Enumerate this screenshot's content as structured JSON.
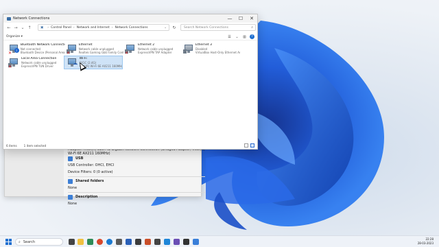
{
  "window": {
    "title": "Network Connections",
    "controls": {
      "minimize": "—",
      "maximize": "☐",
      "close": "✕"
    }
  },
  "nav": {
    "breadcrumb": [
      "Control Panel",
      "Network and Internet",
      "Network Connections"
    ],
    "search_placeholder": "Search Network Connections"
  },
  "command": {
    "organize": "Organize ▾"
  },
  "connections": [
    {
      "name": "Bluetooth Network Connection",
      "status": "Not connected",
      "device": "Bluetooth Device (Personal Area ...",
      "type": "bluetooth",
      "disconnected": true
    },
    {
      "name": "Ethernet",
      "status": "Network cable unplugged",
      "device": "Realtek Gaming GbE Family Contr...",
      "type": "ethernet",
      "disconnected": true
    },
    {
      "name": "Ethernet 2",
      "status": "Network cable unplugged",
      "device": "ExpressVPN TAP Adapter",
      "type": "ethernet",
      "disconnected": true
    },
    {
      "name": "Ethernet 3",
      "status": "Disabled",
      "device": "VirtualBox Host-Only Ethernet Ad...",
      "type": "ethernet",
      "disconnected": false
    },
    {
      "name": "Local Area Connection",
      "status": "Network cable unplugged",
      "device": "ExpressVPN TUN Driver",
      "type": "ethernet",
      "disconnected": true
    },
    {
      "name": "Wi-Fi",
      "status": "EX1C (2.4G)",
      "device": "Intel(R) Wi-Fi 6E AX211 160MHz",
      "type": "wifi",
      "disconnected": false,
      "selected": true
    }
  ],
  "status": {
    "count": "6 items",
    "selected": "1 item selected"
  },
  "background_window": {
    "adapter": "Adapter:  Intel(R) 82574L Gigabit Network Connection (Bridged Adapter, Intel(R) Wi-Fi 6E AX211 160MHz)",
    "usb_title": "USB",
    "usb_controller": "USB Controller:  OHCI, EHCI",
    "device_filters": "Device Filters:  0 (0 active)",
    "shared_title": "Shared folders",
    "shared_value": "None",
    "desc_title": "Description",
    "desc_value": "None"
  },
  "taskbar": {
    "search": "Search",
    "time": "22:28",
    "date": "28-03-2023"
  },
  "colors": {
    "accent": "#1f6fd0",
    "selection": "#cfe3f7"
  }
}
